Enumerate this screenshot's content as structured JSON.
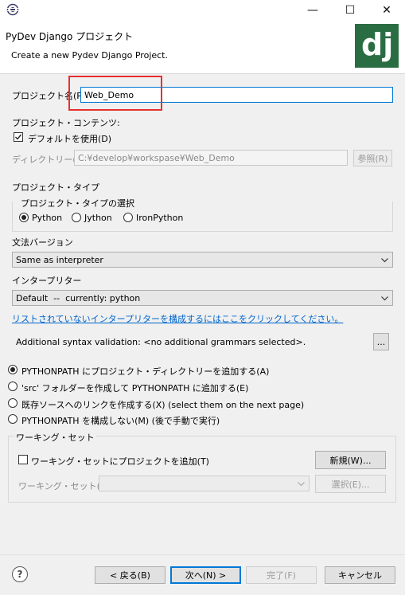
{
  "window": {
    "minimize_glyph": "—",
    "maximize_glyph": "☐",
    "close_glyph": "✕"
  },
  "header": {
    "title": "PyDev Django プロジェクト",
    "message": "Create a new Pydev Django Project.",
    "logo_text": "dj"
  },
  "project": {
    "name_label": "プロジェクト名(P):",
    "name_value": "Web_Demo",
    "contents_label": "プロジェクト・コンテンツ:",
    "use_default_label": "デフォルトを使用(D)",
    "use_default_checked": true,
    "dir_label": "ディレクトリー(Y)",
    "dir_value": "C:¥develop¥workspase¥Web_Demo",
    "browse_label": "参照(R)"
  },
  "project_type": {
    "section_label": "プロジェクト・タイプ",
    "group_label": "プロジェクト・タイプの選択",
    "options": [
      "Python",
      "Jython",
      "IronPython"
    ],
    "selected": "Python"
  },
  "grammar": {
    "label": "文法バージョン",
    "value": "Same as interpreter"
  },
  "interpreter": {
    "label": "インタープリター",
    "value": "Default  --  currently: python",
    "config_link": "リストされていないインタープリターを構成するにはここをクリックしてください。"
  },
  "syntax": {
    "label": "Additional syntax validation: <no additional grammars selected>.",
    "button_label": "..."
  },
  "pythonpath": {
    "options": [
      "PYTHONPATH にプロジェクト・ディレクトリーを追加する(A)",
      "'src' フォルダーを作成して PYTHONPATH に追加する(E)",
      "既存ソースへのリンクを作成する(X) (select them on the next page)",
      "PYTHONPATH を構成しない(M) (後で手動で実行)"
    ],
    "selected_index": 0
  },
  "working_set": {
    "group_label": "ワーキング・セット",
    "add_label": "ワーキング・セットにプロジェクトを追加(T)",
    "add_checked": false,
    "new_button": "新規(W)...",
    "sets_label": "ワーキング・セット(O):",
    "select_button": "選択(E)..."
  },
  "footer": {
    "help_glyph": "?",
    "back": "< 戻る(B)",
    "next": "次へ(N) >",
    "finish": "完了(F)",
    "cancel": "キャンセル"
  }
}
